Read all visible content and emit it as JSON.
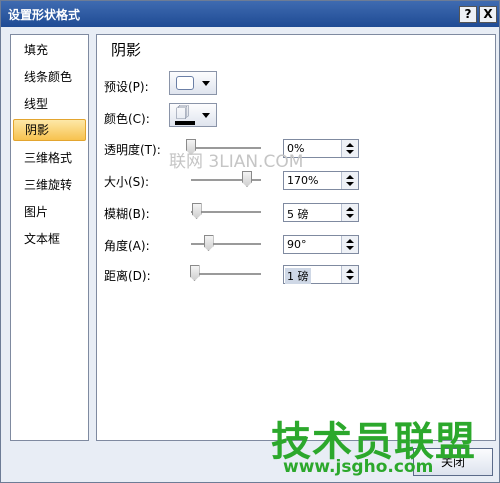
{
  "window": {
    "title": "设置形状格式",
    "help_label": "?",
    "close_label": "X"
  },
  "sidebar": {
    "items": [
      {
        "label": "填充"
      },
      {
        "label": "线条颜色"
      },
      {
        "label": "线型"
      },
      {
        "label": "阴影",
        "active": true
      },
      {
        "label": "三维格式"
      },
      {
        "label": "三维旋转"
      },
      {
        "label": "图片"
      },
      {
        "label": "文本框"
      }
    ]
  },
  "panel": {
    "title": "阴影",
    "preset": {
      "label": "预设(P):"
    },
    "color": {
      "label": "颜色(C):",
      "icon": "paint-bucket-icon"
    },
    "transparency": {
      "label": "透明度(T):",
      "value": "0%",
      "slider_fraction": 0.0
    },
    "size": {
      "label": "大小(S):",
      "value": "170%",
      "slider_fraction": 0.8
    },
    "blur": {
      "label": "模糊(B):",
      "value": "5 磅",
      "slider_fraction": 0.08
    },
    "angle": {
      "label": "角度(A):",
      "value": "90°",
      "slider_fraction": 0.25
    },
    "distance": {
      "label": "距离(D):",
      "value": "1 磅",
      "slider_fraction": 0.05
    }
  },
  "footer": {
    "close_label": "关闭"
  },
  "watermarks": {
    "top": "联网 3LIAN.COM",
    "logo": "技术员联盟",
    "url": "www.jsgho.com"
  }
}
